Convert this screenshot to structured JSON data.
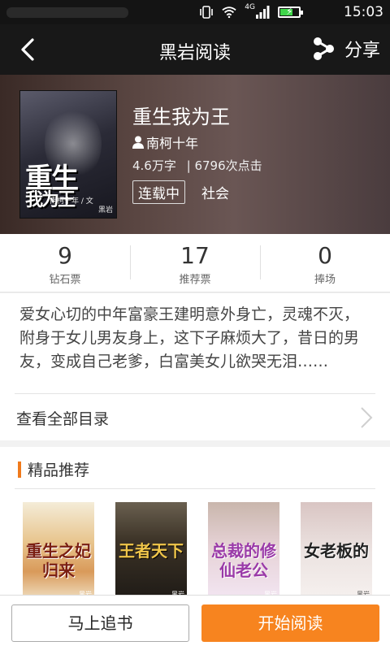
{
  "status_bar": {
    "time": "15:03",
    "network_label": "4G",
    "battery_level": 0.7,
    "icons": [
      "vibrate-icon",
      "wifi-icon",
      "signal-icon",
      "battery-charging-icon"
    ]
  },
  "titlebar": {
    "title": "黑岩阅读",
    "share_label": "分享",
    "icons": [
      "back-icon",
      "share-icon"
    ]
  },
  "book": {
    "title": "重生我为王",
    "author": "南柯十年",
    "word_count": "4.6万字",
    "clicks": "| 6796次点击",
    "status": "连载中",
    "category": "社会",
    "cover": {
      "title_line1": "重生",
      "title_line2": "我为王",
      "author_line": "南柯十年 / 文",
      "publisher": "黑岩"
    }
  },
  "tickets": [
    {
      "value": "9",
      "label": "钻石票"
    },
    {
      "value": "17",
      "label": "推荐票"
    },
    {
      "value": "0",
      "label": "捧场"
    }
  ],
  "description": "爱女心切的中年富豪王建明意外身亡，灵魂不灭，附身于女儿男友身上，这下子麻烦大了，昔日的男友，变成自己老爹，白富美女儿欲哭无泪……",
  "catalog_label": "查看全部目录",
  "recommendations": {
    "heading": "精品推荐",
    "accent_color": "#f07a1c",
    "items": [
      {
        "cover_title": "重生之妃归来",
        "cover_subtitle": "",
        "publisher": "黑岩"
      },
      {
        "cover_title": "王者天下",
        "cover_subtitle": "",
        "publisher": "黑岩"
      },
      {
        "cover_title": "总裁的修仙老公",
        "cover_subtitle": "",
        "publisher": "黑岩"
      },
      {
        "cover_title": "女老板的",
        "cover_subtitle": "",
        "publisher": "黑岩"
      }
    ]
  },
  "actions": {
    "follow_label": "马上追书",
    "read_label": "开始阅读",
    "read_color": "#f7841f"
  }
}
